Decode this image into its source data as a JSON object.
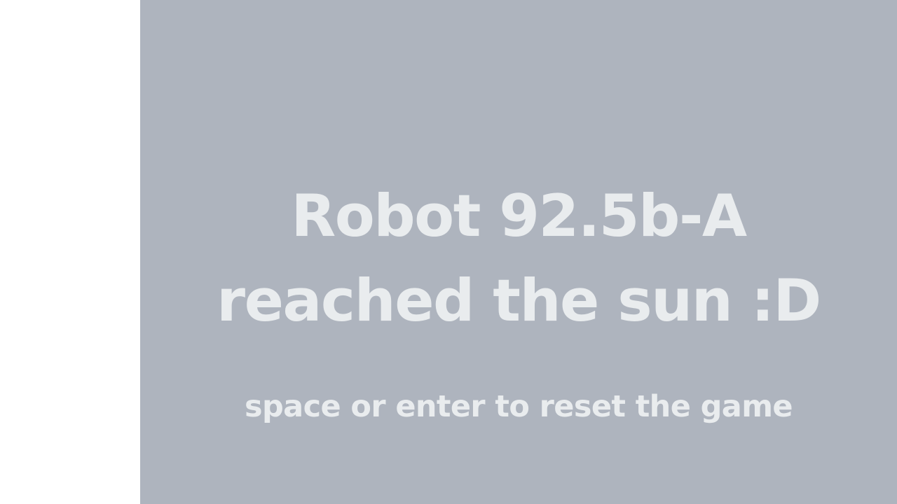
{
  "game": {
    "message_line_1": "Robot 92.5b-A",
    "message_line_2": "reached the sun :D",
    "hint": "space or enter to reset the game"
  },
  "colors": {
    "background": "#aeb4be",
    "text": "#e9ecee",
    "page": "#ffffff"
  }
}
